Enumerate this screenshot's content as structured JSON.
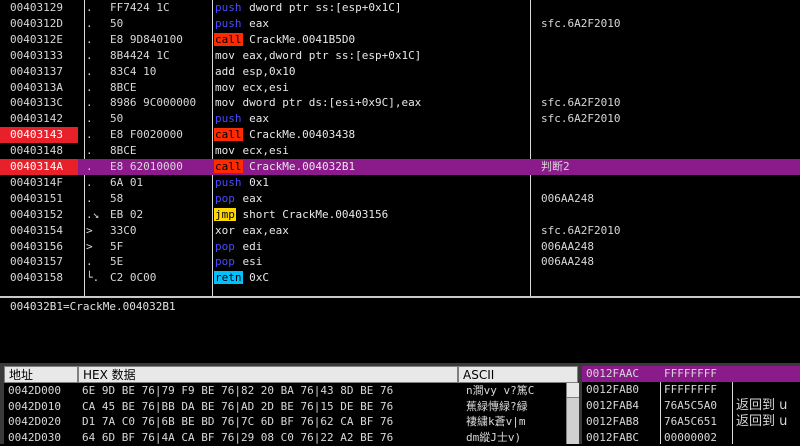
{
  "disasm": {
    "rows": [
      {
        "addr": "00403129",
        "mark": ".",
        "hex": "FF7424 1C",
        "mn": "push",
        "mnclass": "push",
        "ops": "dword ptr ss:[esp+0x1C]",
        "comment": ""
      },
      {
        "addr": "0040312D",
        "mark": ".",
        "hex": "50",
        "mn": "push",
        "mnclass": "push",
        "ops": "eax",
        "comment": "sfc.6A2F2010"
      },
      {
        "addr": "0040312E",
        "mark": ".",
        "hex": "E8 9D840100",
        "mn": "call",
        "mnclass": "call",
        "ops": "CrackMe.0041B5D0",
        "comment": ""
      },
      {
        "addr": "00403133",
        "mark": ".",
        "hex": "8B4424 1C",
        "mn": "mov",
        "mnclass": "mov",
        "ops": "eax,dword ptr ss:[esp+0x1C]",
        "comment": ""
      },
      {
        "addr": "00403137",
        "mark": ".",
        "hex": "83C4 10",
        "mn": "add",
        "mnclass": "add",
        "ops": "esp,0x10",
        "comment": ""
      },
      {
        "addr": "0040313A",
        "mark": ".",
        "hex": "8BCE",
        "mn": "mov",
        "mnclass": "mov",
        "ops": "ecx,esi",
        "comment": ""
      },
      {
        "addr": "0040313C",
        "mark": ".",
        "hex": "8986 9C000000",
        "mn": "mov",
        "mnclass": "mov",
        "ops": "dword ptr ds:[esi+0x9C],eax",
        "comment": "sfc.6A2F2010"
      },
      {
        "addr": "00403142",
        "mark": ".",
        "hex": "50",
        "mn": "push",
        "mnclass": "push",
        "ops": "eax",
        "comment": "sfc.6A2F2010"
      },
      {
        "addr": "00403143",
        "mark": ".",
        "hex": "E8 F0020000",
        "mn": "call",
        "mnclass": "call",
        "ops": "CrackMe.00403438",
        "comment": "",
        "bp": true
      },
      {
        "addr": "00403148",
        "mark": ".",
        "hex": "8BCE",
        "mn": "mov",
        "mnclass": "mov",
        "ops": "ecx,esi",
        "comment": ""
      },
      {
        "addr": "0040314A",
        "mark": ".",
        "hex": "E8 62010000",
        "mn": "call",
        "mnclass": "call",
        "ops": "CrackMe.004032B1",
        "comment": "判断2",
        "sel": true
      },
      {
        "addr": "0040314F",
        "mark": ".",
        "hex": "6A 01",
        "mn": "push",
        "mnclass": "push",
        "ops": "0x1",
        "comment": ""
      },
      {
        "addr": "00403151",
        "mark": ".",
        "hex": "58",
        "mn": "pop",
        "mnclass": "pop",
        "ops": "eax",
        "comment": "006AA248"
      },
      {
        "addr": "00403152",
        "mark": ".↘",
        "hex": "EB 02",
        "mn": "jmp",
        "mnclass": "jmp",
        "ops": "short CrackMe.00403156",
        "comment": ""
      },
      {
        "addr": "00403154",
        "mark": ">",
        "hex": "33C0",
        "mn": "xor",
        "mnclass": "xor",
        "ops": "eax,eax",
        "comment": "sfc.6A2F2010"
      },
      {
        "addr": "00403156",
        "mark": ">",
        "hex": "5F",
        "mn": "pop",
        "mnclass": "pop",
        "ops": "edi",
        "comment": "006AA248"
      },
      {
        "addr": "00403157",
        "mark": ".",
        "hex": "5E",
        "mn": "pop",
        "mnclass": "pop",
        "ops": "esi",
        "comment": "006AA248"
      },
      {
        "addr": "00403158",
        "mark": "└.",
        "hex": "C2 0C00",
        "mn": "retn",
        "mnclass": "retn",
        "ops": "0xC",
        "comment": ""
      }
    ]
  },
  "info": {
    "text": "004032B1=CrackMe.004032B1"
  },
  "dump": {
    "header_addr": "地址",
    "header_hex": "HEX 数据",
    "header_ascii": "ASCII",
    "rows": [
      {
        "addr": "0042D000",
        "hex": "6E 9D BE 76|79 F9 BE 76|82 20 BA 76|43 8D BE 76",
        "ascii": "n澗vy  v?篤C"
      },
      {
        "addr": "0042D010",
        "hex": "CA 45 BE 76|BB DA BE 76|AD 2D BE 76|15 DE BE 76",
        "ascii": "蕉緑慱緑?緑"
      },
      {
        "addr": "0042D020",
        "hex": "D1 7A C0 76|6B BE BD 76|7C 6D BF 76|62 CA BF 76",
        "ascii": "褄繍k蒼v|m"
      },
      {
        "addr": "0042D030",
        "hex": "64 6D BF 76|4A CA BF 76|29 08 C0 76|22 A2 BE 76",
        "ascii": "dm縱J士v)"
      }
    ]
  },
  "stack": {
    "rows": [
      {
        "addr": "0012FAAC",
        "val": "FFFFFFFF",
        "comment": "",
        "top": true
      },
      {
        "addr": "0012FAB0",
        "val": "FFFFFFFF",
        "comment": ""
      },
      {
        "addr": "0012FAB4",
        "val": "76A5C5A0",
        "comment": "返回到 u"
      },
      {
        "addr": "0012FAB8",
        "val": "76A5C651",
        "comment": "返回到 u"
      },
      {
        "addr": "0012FABC",
        "val": "00000002",
        "comment": ""
      }
    ]
  }
}
